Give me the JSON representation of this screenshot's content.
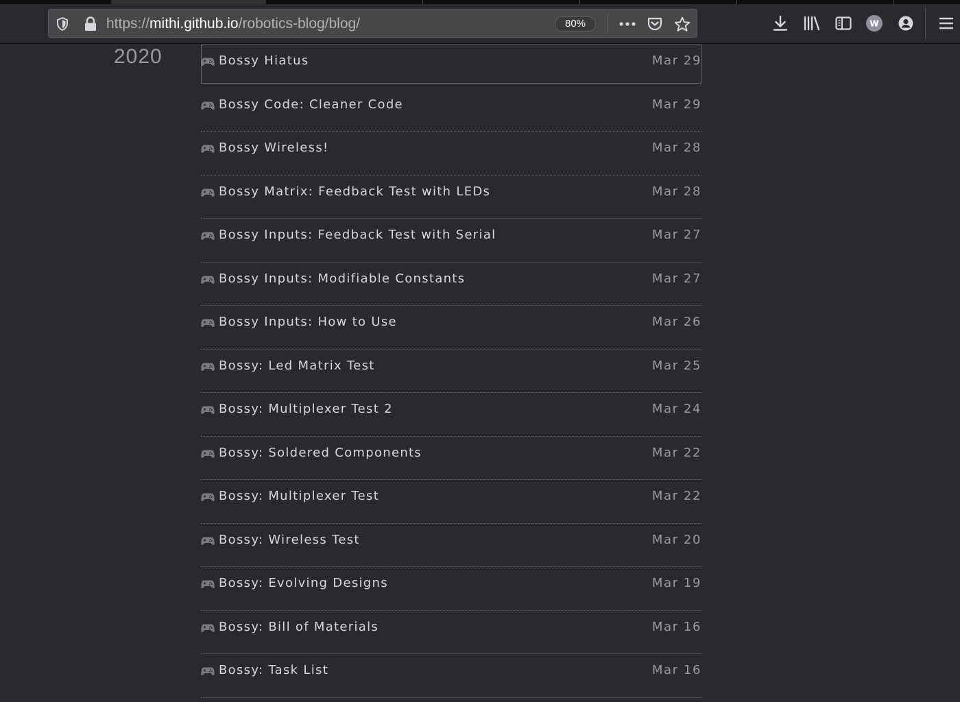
{
  "browser": {
    "url_scheme": "https://",
    "url_host": "mithi.github.io",
    "url_path": "/robotics-blog/blog/",
    "zoom": "80%",
    "account_initial": "W"
  },
  "archive": {
    "year": "2020",
    "posts": [
      {
        "title": "Bossy Hiatus",
        "date": "Mar 29"
      },
      {
        "title": "Bossy Code: Cleaner Code",
        "date": "Mar 29"
      },
      {
        "title": "Bossy Wireless!",
        "date": "Mar 28"
      },
      {
        "title": "Bossy Matrix: Feedback Test with LEDs",
        "date": "Mar 28"
      },
      {
        "title": "Bossy Inputs: Feedback Test with Serial",
        "date": "Mar 27"
      },
      {
        "title": "Bossy Inputs: Modifiable Constants",
        "date": "Mar 27"
      },
      {
        "title": "Bossy Inputs: How to Use",
        "date": "Mar 26"
      },
      {
        "title": "Bossy: Led Matrix Test",
        "date": "Mar 25"
      },
      {
        "title": "Bossy: Multiplexer Test 2",
        "date": "Mar 24"
      },
      {
        "title": "Bossy: Soldered Components",
        "date": "Mar 22"
      },
      {
        "title": "Bossy: Multiplexer Test",
        "date": "Mar 22"
      },
      {
        "title": "Bossy: Wireless Test",
        "date": "Mar 20"
      },
      {
        "title": "Bossy: Evolving Designs",
        "date": "Mar 19"
      },
      {
        "title": "Bossy: Bill of Materials",
        "date": "Mar 16"
      },
      {
        "title": "Bossy: Task List",
        "date": "Mar 16"
      }
    ]
  }
}
